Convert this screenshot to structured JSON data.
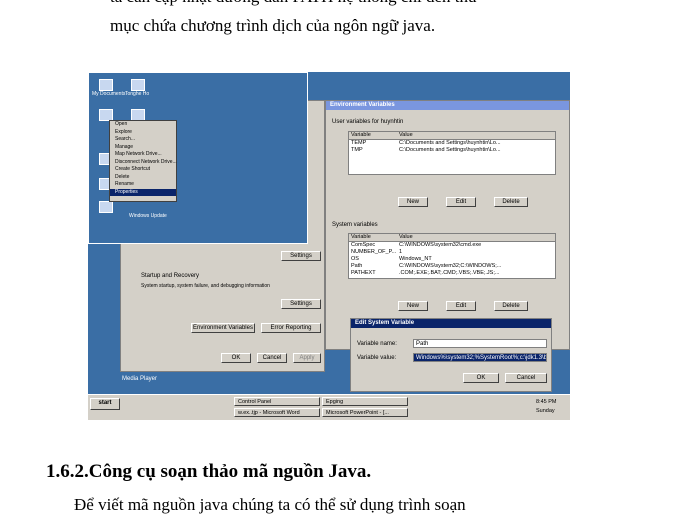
{
  "paragraph": {
    "line1": "ta cần cập nhật đường dẫn PATH hệ thống chỉ đến thư",
    "line2": "mục chứa chương trình dịch của ngôn ngữ java."
  },
  "screenshot": {
    "desktop_icons": [
      "My Documents",
      "Tonghe Ho",
      "My Computer",
      "My Network Places",
      "Internet Explorer",
      "Recycle Bin",
      "Windows Update"
    ],
    "context_menu": [
      "Open",
      "Explore",
      "Search...",
      "Manage",
      "Map Network Drive...",
      "Disconnect Network Drive...",
      "Create Shortcut",
      "Delete",
      "Rename",
      "Properties"
    ],
    "context_menu_selected_index": 9,
    "env_dialog": {
      "title": "Environment Variables",
      "user_group": "User variables for huynhtin",
      "col_variable": "Variable",
      "col_value": "Value",
      "user_vars": [
        {
          "name": "TEMP",
          "value": "C:\\Documents and Settings\\huynhtin\\Lo..."
        },
        {
          "name": "TMP",
          "value": "C:\\Documents and Settings\\huynhtin\\Lo..."
        }
      ],
      "new": "New",
      "edit": "Edit",
      "delete": "Delete",
      "system_group": "System variables",
      "system_vars": [
        {
          "name": "ComSpec",
          "value": "C:\\WINDOWS\\system32\\cmd.exe"
        },
        {
          "name": "NUMBER_OF_P...",
          "value": "1"
        },
        {
          "name": "OS",
          "value": "Windows_NT"
        },
        {
          "name": "Path",
          "value": "C:\\WINDOWS\\system32;C:\\WINDOWS;..."
        },
        {
          "name": "PATHEXT",
          "value": ".COM;.EXE;.BAT;.CMD;.VBS;.VBE;.JS;..."
        }
      ]
    },
    "sysprop": {
      "settings": "Settings",
      "startup_label": "Startup and Recovery",
      "startup_desc": "System startup, system failure, and debugging information",
      "env_vars_button": "Environment Variables",
      "error_reporting": "Error Reporting",
      "ok": "OK",
      "cancel": "Cancel",
      "apply": "Apply"
    },
    "edit_dialog": {
      "title": "Edit System Variable",
      "name_label": "Variable name:",
      "name_value": "Path",
      "value_label": "Variable value:",
      "value_value": "Windows%\\system32;%SystemRoot%;c:\\jdk1.3\\bin",
      "ok": "OK",
      "cancel": "Cancel"
    },
    "taskbar": {
      "start": "start",
      "tasks": [
        "Control Panel",
        "Epging",
        "w.ex..tjp - Microsoft Word",
        "Microsoft PowerPoint - [..."
      ],
      "clock": "8:45 PM",
      "day": "Sunday"
    },
    "media_player_label": "Media Player"
  },
  "section": {
    "heading": "1.6.2.Công cụ soạn thảo mã nguồn Java."
  },
  "next_line": "Để viết mã nguồn java chúng ta có thể sử dụng trình soạn"
}
